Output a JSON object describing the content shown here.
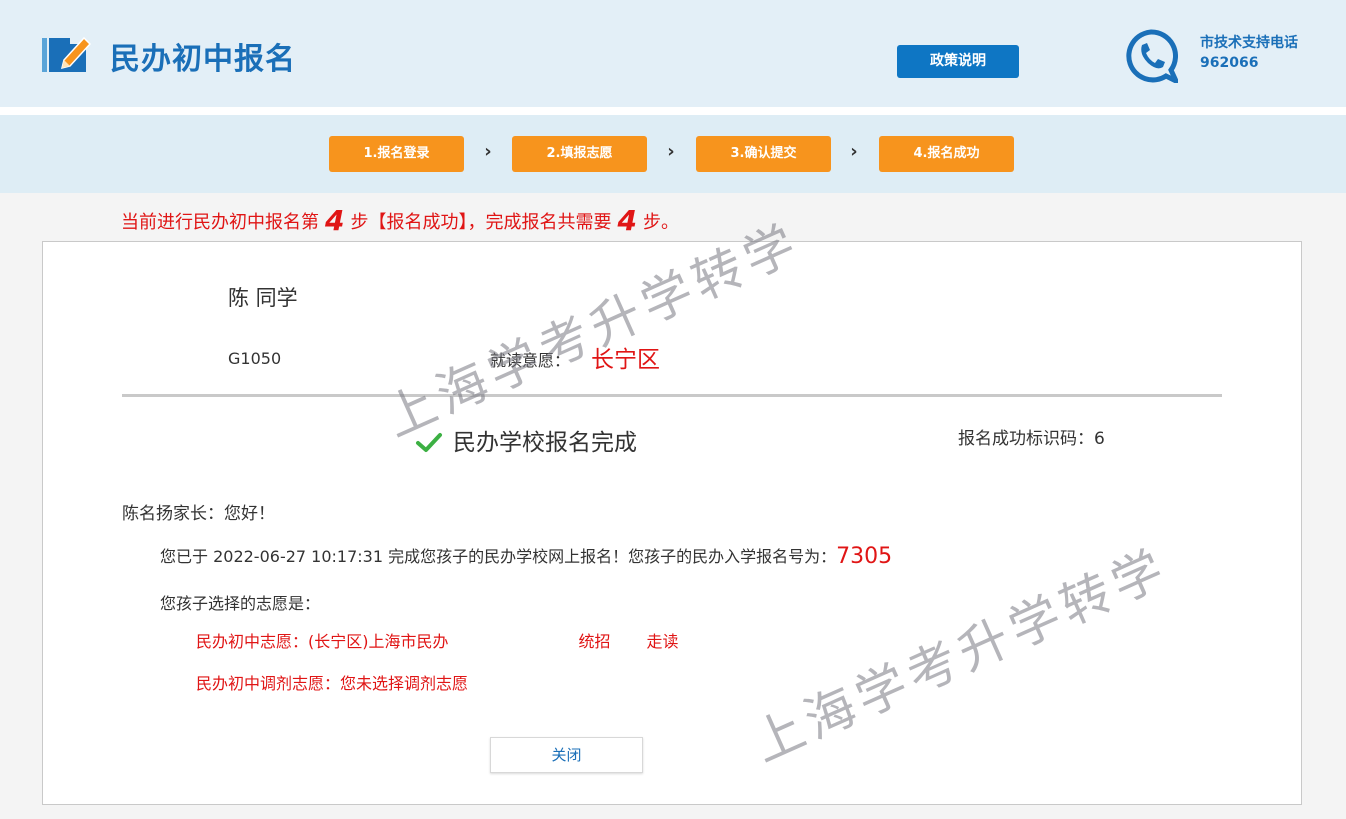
{
  "header": {
    "title": "民办初中报名",
    "policy_button": "政策说明",
    "support_label": "市技术支持电话",
    "support_phone": "962066"
  },
  "steps": [
    {
      "label": "1.报名登录"
    },
    {
      "label": "2.填报志愿"
    },
    {
      "label": "3.确认提交"
    },
    {
      "label": "4.报名成功"
    }
  ],
  "notice": {
    "prefix": "当前进行民办初中报名第",
    "current_step": "4",
    "middle": "步【报名成功】，完成报名共需要",
    "total_steps": "4",
    "suffix": "步。"
  },
  "student": {
    "name": "陈  同学",
    "id": "G1050",
    "intent_label": "就读意愿：",
    "intent_value": "长宁区"
  },
  "result": {
    "done_text": "民办学校报名完成",
    "success_code_label": "报名成功标识码：",
    "success_code_value": "6"
  },
  "letter": {
    "greeting": "陈名扬家长：您好！",
    "message": "您已于 2022-06-27 10:17:31 完成您孩子的民办学校网上报名！您孩子的民办入学报名号为：",
    "reg_number": "7305",
    "choices_label": "您孩子选择的志愿是：",
    "choice1_prefix": "民办初中志愿：(长宁区)上海市民办",
    "choice1_type": "统招",
    "choice1_mode": "走读",
    "choice2": "民办初中调剂志愿：您未选择调剂志愿"
  },
  "close_button": "关闭",
  "watermark": "上海学考升学转学",
  "colors": {
    "brand_blue": "#1a6fb8",
    "button_blue": "#0e76c4",
    "step_orange": "#f7941d",
    "alert_red": "#e01515"
  }
}
